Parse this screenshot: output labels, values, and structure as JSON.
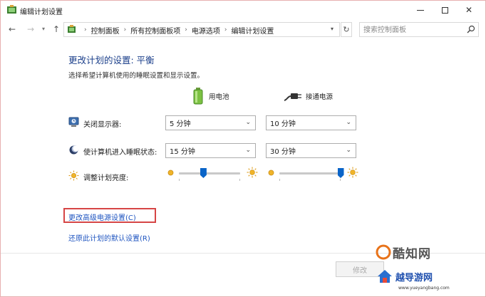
{
  "window": {
    "title": "编辑计划设置",
    "controls": {
      "minimize": "—",
      "maximize": "□",
      "close": "✕"
    }
  },
  "navigation": {
    "back_icon": "left-arrow",
    "forward_icon": "right-arrow",
    "up_icon": "up-arrow",
    "breadcrumbs": [
      "控制面板",
      "所有控制面板项",
      "电源选项",
      "编辑计划设置"
    ],
    "separator": "›",
    "search_placeholder": "搜索控制面板"
  },
  "plan": {
    "heading": "更改计划的设置: 平衡",
    "description": "选择希望计算机使用的睡眠设置和显示设置。",
    "columns": {
      "battery": "用电池",
      "plugged_in": "接通电源"
    },
    "rows": [
      {
        "label": "关闭显示器:",
        "battery": "5 分钟",
        "plugged_in": "10 分钟"
      },
      {
        "label": "使计算机进入睡眠状态:",
        "battery": "15 分钟",
        "plugged_in": "30 分钟"
      }
    ],
    "brightness": {
      "label": "调整计划亮度:",
      "battery_level": 0.4,
      "plugged_in_level": 1.0
    }
  },
  "links": {
    "advanced": "更改高级电源设置(C)",
    "restore": "还原此计划的默认设置(R)"
  },
  "footer": {
    "button_partial": "修改"
  },
  "watermark": {
    "main": "酷知网",
    "sub": "越导游网",
    "url": "www.yueyangbang.com"
  },
  "colors": {
    "heading": "#1a3e8a",
    "link": "#1f55c0",
    "highlight_box": "#d64545",
    "slider_thumb": "#0a64c8"
  }
}
